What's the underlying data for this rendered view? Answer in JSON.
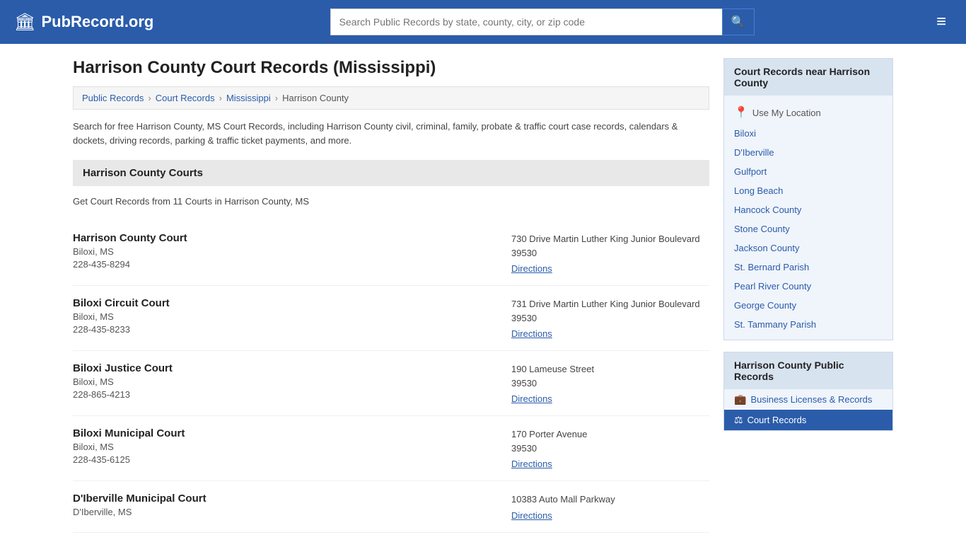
{
  "header": {
    "logo_icon": "🏛",
    "logo_text": "PubRecord.org",
    "search_placeholder": "Search Public Records by state, county, city, or zip code",
    "search_icon": "🔍",
    "menu_icon": "≡"
  },
  "page": {
    "title": "Harrison County Court Records (Mississippi)",
    "breadcrumbs": [
      {
        "label": "Public Records",
        "url": "#"
      },
      {
        "label": "Court Records",
        "url": "#"
      },
      {
        "label": "Mississippi",
        "url": "#"
      },
      {
        "label": "Harrison County",
        "url": "#"
      }
    ],
    "description": "Search for free Harrison County, MS Court Records, including Harrison County civil, criminal, family, probate & traffic court case records, calendars & dockets, driving records, parking & traffic ticket payments, and more.",
    "section_title": "Harrison County Courts",
    "sub_description": "Get Court Records from 11 Courts in Harrison County, MS",
    "courts": [
      {
        "name": "Harrison County Court",
        "city": "Biloxi, MS",
        "phone": "228-435-8294",
        "address": "730 Drive Martin Luther King Junior Boulevard",
        "zip": "39530",
        "directions_label": "Directions"
      },
      {
        "name": "Biloxi Circuit Court",
        "city": "Biloxi, MS",
        "phone": "228-435-8233",
        "address": "731 Drive Martin Luther King Junior Boulevard",
        "zip": "39530",
        "directions_label": "Directions"
      },
      {
        "name": "Biloxi Justice Court",
        "city": "Biloxi, MS",
        "phone": "228-865-4213",
        "address": "190 Lameuse Street",
        "zip": "39530",
        "directions_label": "Directions"
      },
      {
        "name": "Biloxi Municipal Court",
        "city": "Biloxi, MS",
        "phone": "228-435-6125",
        "address": "170 Porter Avenue",
        "zip": "39530",
        "directions_label": "Directions"
      },
      {
        "name": "D'Iberville Municipal Court",
        "city": "D'Iberville, MS",
        "phone": "",
        "address": "10383 Auto Mall Parkway",
        "zip": "",
        "directions_label": "Directions"
      }
    ]
  },
  "sidebar": {
    "nearby_title": "Court Records near Harrison County",
    "use_my_location": "Use My Location",
    "nearby_items": [
      "Biloxi",
      "D'Iberville",
      "Gulfport",
      "Long Beach",
      "Hancock County",
      "Stone County",
      "Jackson County",
      "St. Bernard Parish",
      "Pearl River County",
      "George County",
      "St. Tammany Parish"
    ],
    "public_records_title": "Harrison County Public Records",
    "public_records_items": [
      {
        "label": "Business Licenses & Records",
        "icon": "💼",
        "active": false
      },
      {
        "label": "Court Records",
        "icon": "⚖",
        "active": true
      }
    ]
  }
}
